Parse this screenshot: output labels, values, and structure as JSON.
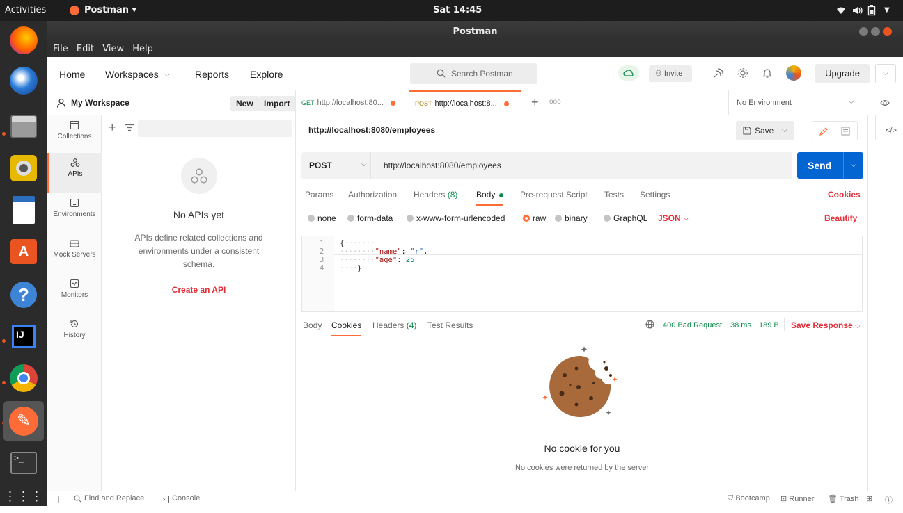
{
  "topbar": {
    "activities": "Activities",
    "app_name": "Postman ▾",
    "clock": "Sat 14:45"
  },
  "window": {
    "title": "Postman"
  },
  "menu": {
    "file": "File",
    "edit": "Edit",
    "view": "View",
    "help": "Help"
  },
  "header": {
    "home": "Home",
    "workspaces": "Workspaces",
    "reports": "Reports",
    "explore": "Explore",
    "search_placeholder": "Search Postman",
    "invite": "Invite",
    "upgrade": "Upgrade"
  },
  "workspace": {
    "name": "My Workspace",
    "new_btn": "New",
    "import_btn": "Import"
  },
  "tabs": [
    {
      "method": "GET",
      "url": "http://localhost:80..."
    },
    {
      "method": "POST",
      "url": "http://localhost:8..."
    }
  ],
  "environment": "No Environment",
  "rail": [
    {
      "label": "Collections"
    },
    {
      "label": "APIs"
    },
    {
      "label": "Environments"
    },
    {
      "label": "Mock Servers"
    },
    {
      "label": "Monitors"
    },
    {
      "label": "History"
    }
  ],
  "apis_empty": {
    "title": "No APIs yet",
    "desc": "APIs define related collections and environments under a consistent schema.",
    "cta": "Create an API"
  },
  "request": {
    "title": "http://localhost:8080/employees",
    "save": "Save",
    "method": "POST",
    "url": "http://localhost:8080/employees",
    "send": "Send"
  },
  "req_tabs": {
    "params": "Params",
    "authorization": "Authorization",
    "headers": "Headers",
    "headers_count": "(8)",
    "body": "Body",
    "prerequest": "Pre-request Script",
    "tests": "Tests",
    "settings": "Settings",
    "cookies": "Cookies"
  },
  "body_types": {
    "none": "none",
    "form_data": "form-data",
    "urlencoded": "x-www-form-urlencoded",
    "raw": "raw",
    "binary": "binary",
    "graphql": "GraphQL",
    "json": "JSON",
    "beautify": "Beautify"
  },
  "code": {
    "line_numbers": [
      "1",
      "2",
      "3",
      "4"
    ],
    "open_brace": "{",
    "name_key": "\"name\"",
    "name_val": "\"r\"",
    "age_key": "\"age\"",
    "age_val": "25",
    "close_brace": "}"
  },
  "response": {
    "body": "Body",
    "cookies": "Cookies",
    "headers": "Headers",
    "headers_count": "(4)",
    "test_results": "Test Results",
    "status": "400 Bad Request",
    "time": "38 ms",
    "size": "189 B",
    "save_response": "Save Response"
  },
  "empty_cookies": {
    "title": "No cookie for you",
    "desc": "No cookies were returned by the server"
  },
  "statusbar": {
    "find_replace": "Find and Replace",
    "console": "Console",
    "bootcamp": "Bootcamp",
    "runner": "Runner",
    "trash": "Trash"
  },
  "colors": {
    "accent": "#ff6c37",
    "send_blue": "#0265d2",
    "link_red": "#e2303a",
    "status_green": "#0b8a4a"
  }
}
